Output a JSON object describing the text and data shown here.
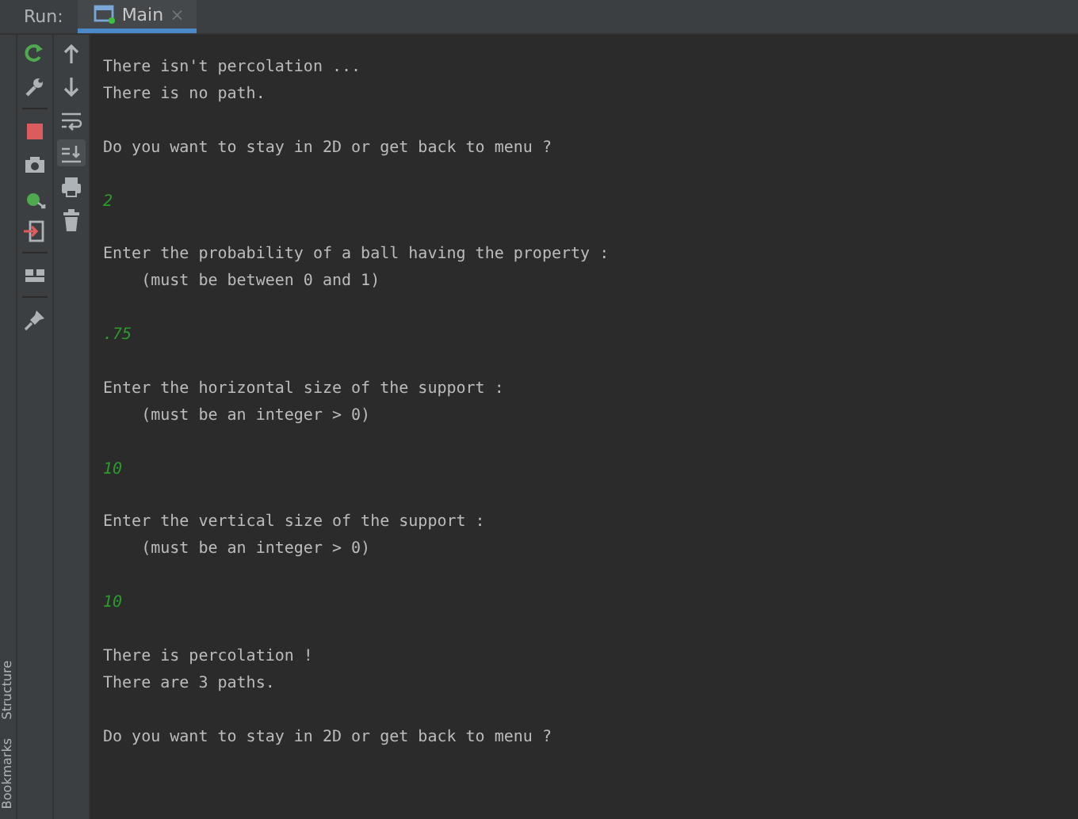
{
  "run_bar": {
    "label": "Run:",
    "tabs": [
      {
        "label": "Main",
        "close": "×",
        "selected": true
      }
    ]
  },
  "side_tabs": [
    {
      "label": "Structure"
    },
    {
      "label": "Bookmarks"
    }
  ],
  "console": {
    "blocks": [
      {
        "lines": [
          {
            "kind": "output",
            "text": "There isn't percolation ..."
          },
          {
            "kind": "output",
            "text": "There is no path."
          }
        ]
      },
      {
        "lines": [
          {
            "kind": "output",
            "text": "Do you want to stay in 2D or get back to menu ?"
          }
        ]
      },
      {
        "lines": [
          {
            "kind": "input",
            "text": "2"
          }
        ]
      },
      {
        "lines": [
          {
            "kind": "output",
            "text": "Enter the probability of a ball having the property :"
          },
          {
            "kind": "output",
            "text": "    (must be between 0 and 1)"
          }
        ]
      },
      {
        "lines": [
          {
            "kind": "input",
            "text": ".75"
          }
        ]
      },
      {
        "lines": [
          {
            "kind": "output",
            "text": "Enter the horizontal size of the support :"
          },
          {
            "kind": "output",
            "text": "    (must be an integer > 0)"
          }
        ]
      },
      {
        "lines": [
          {
            "kind": "input",
            "text": "10"
          }
        ]
      },
      {
        "lines": [
          {
            "kind": "output",
            "text": "Enter the vertical size of the support :"
          },
          {
            "kind": "output",
            "text": "    (must be an integer > 0)"
          }
        ]
      },
      {
        "lines": [
          {
            "kind": "input",
            "text": "10"
          }
        ]
      },
      {
        "lines": [
          {
            "kind": "output",
            "text": "There is percolation !"
          },
          {
            "kind": "output",
            "text": "There are 3 paths."
          }
        ]
      },
      {
        "lines": [
          {
            "kind": "output",
            "text": "Do you want to stay in 2D or get back to menu ?"
          }
        ]
      }
    ]
  }
}
